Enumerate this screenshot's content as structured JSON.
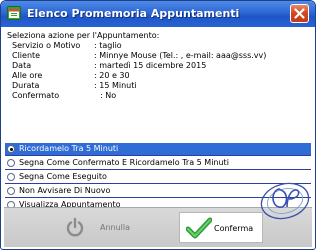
{
  "window": {
    "title": "Elenco Promemoria Appuntamenti",
    "accent": "#2d67d6"
  },
  "details": {
    "heading": "Seleziona azione per l'Appuntamento:",
    "rows": [
      {
        "label": "Servizio o Motivo",
        "value": ": taglio"
      },
      {
        "label": "Cliente",
        "value": ": Minnye Mouse (Tel.: , e-mail: aaa@sss.vv)"
      },
      {
        "label": "Data",
        "value": ": martedì 15 dicembre 2015"
      },
      {
        "label": "Alle ore",
        "value": ": 20 e 30"
      },
      {
        "label": "Durata",
        "value": ": 15 Minuti"
      },
      {
        "label": "Confermato",
        "value": ": No"
      }
    ]
  },
  "options": [
    {
      "label": "Ricordamelo Tra 5 Minuti",
      "selected": true
    },
    {
      "label": "Segna Come Confermato E Ricordamelo Tra 5 Minuti",
      "selected": false
    },
    {
      "label": "Segna Come Eseguito",
      "selected": false
    },
    {
      "label": "Non Avvisare Di Nuovo",
      "selected": false
    },
    {
      "label": "Visualizza Appuntamento",
      "selected": false
    }
  ],
  "buttons": {
    "cancel_label": "Annulla",
    "confirm_label": "Conferma"
  },
  "icons": {
    "app": "calendar-icon",
    "close": "close-icon",
    "cancel": "power-icon",
    "confirm": "checkmark-icon",
    "logo": "brand-logo"
  },
  "colors": {
    "selected_row": "#2f6cd6",
    "row_border": "#2b3f9e",
    "confirm_check": "#3bb34a"
  }
}
